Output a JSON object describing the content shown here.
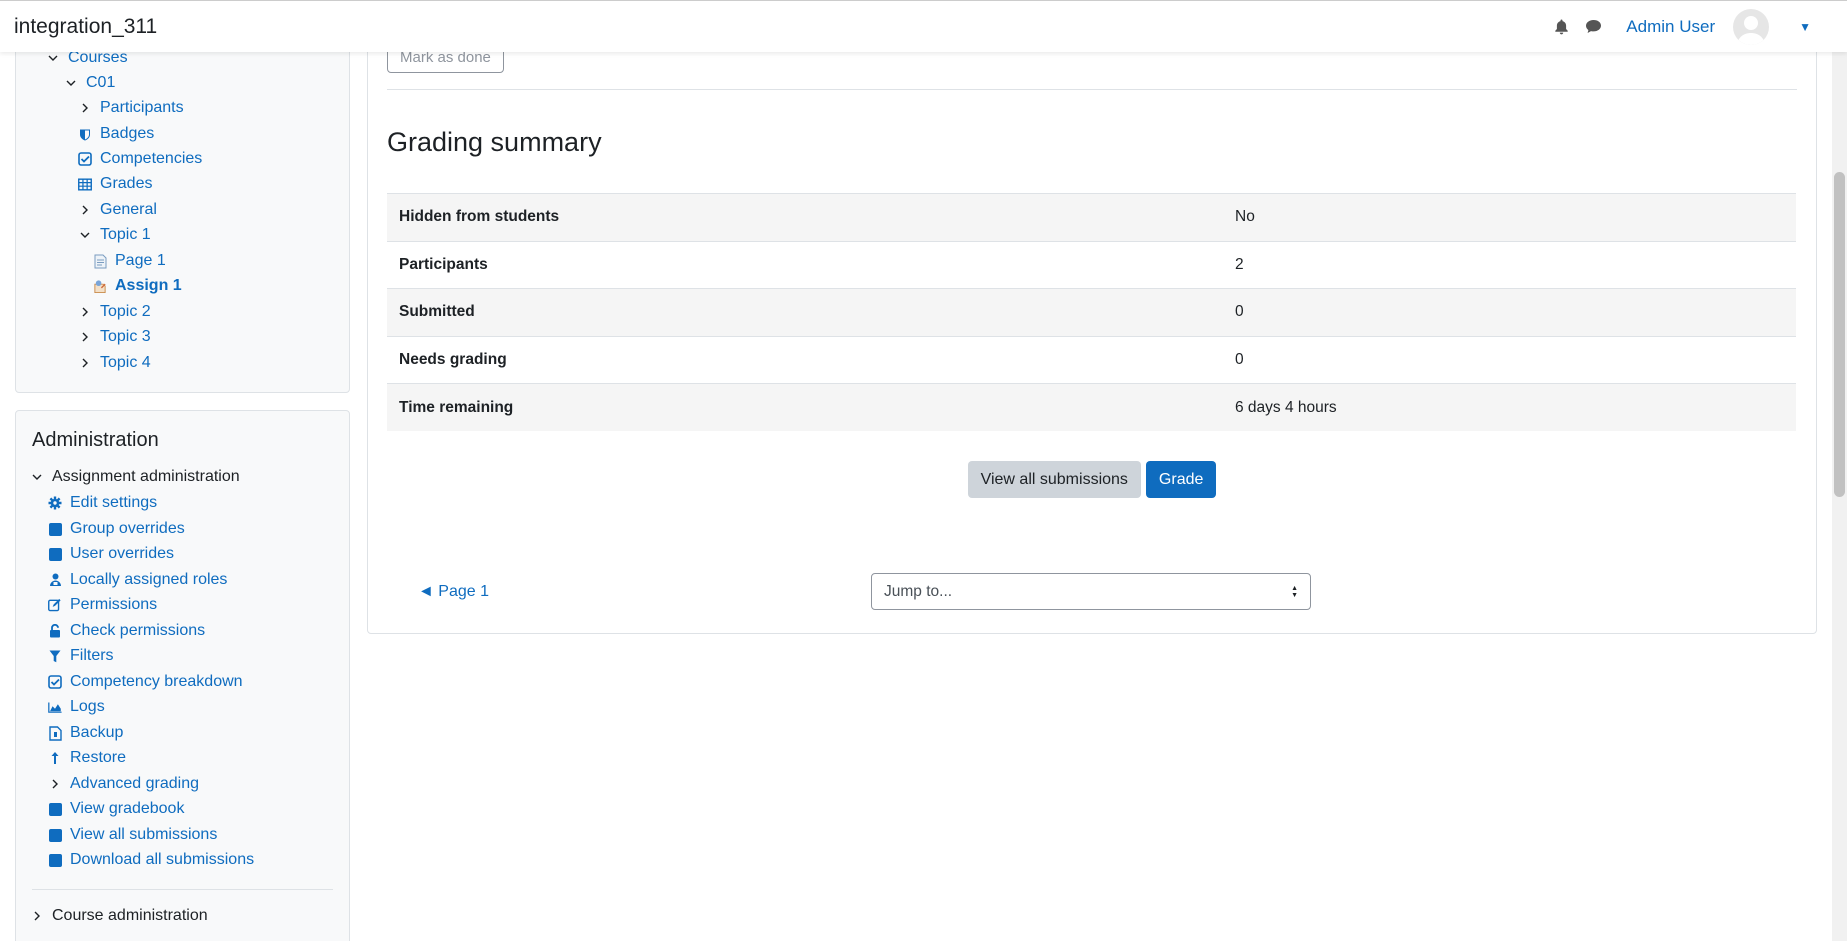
{
  "navbar": {
    "site_name": "integration_311",
    "user_name": "Admin User"
  },
  "nav_tree": [
    {
      "label": "Courses",
      "icon": "chevron-down",
      "indent": 0
    },
    {
      "label": "C01",
      "icon": "chevron-down",
      "indent": 1
    },
    {
      "label": "Participants",
      "icon": "chevron-right",
      "indent": 2
    },
    {
      "label": "Badges",
      "icon": "shield-icon",
      "indent": 2
    },
    {
      "label": "Competencies",
      "icon": "check-square-icon",
      "indent": 2
    },
    {
      "label": "Grades",
      "icon": "table-icon",
      "indent": 2
    },
    {
      "label": "General",
      "icon": "chevron-right",
      "indent": 2
    },
    {
      "label": "Topic 1",
      "icon": "chevron-down",
      "indent": 2
    },
    {
      "label": "Page 1",
      "icon": "page-icon",
      "indent": 3
    },
    {
      "label": "Assign 1",
      "icon": "assignment-icon",
      "indent": 3,
      "bold": true
    },
    {
      "label": "Topic 2",
      "icon": "chevron-right",
      "indent": 2
    },
    {
      "label": "Topic 3",
      "icon": "chevron-right",
      "indent": 2
    },
    {
      "label": "Topic 4",
      "icon": "chevron-right",
      "indent": 2
    }
  ],
  "admin": {
    "title": "Administration",
    "section": "Assignment administration",
    "items": [
      {
        "label": "Edit settings",
        "icon": "gear-icon"
      },
      {
        "label": "Group overrides",
        "icon": "square-icon"
      },
      {
        "label": "User overrides",
        "icon": "square-icon"
      },
      {
        "label": "Locally assigned roles",
        "icon": "user-roles-icon"
      },
      {
        "label": "Permissions",
        "icon": "edit-icon"
      },
      {
        "label": "Check permissions",
        "icon": "unlock-icon"
      },
      {
        "label": "Filters",
        "icon": "filter-icon"
      },
      {
        "label": "Competency breakdown",
        "icon": "check-square-icon"
      },
      {
        "label": "Logs",
        "icon": "area-chart-icon"
      },
      {
        "label": "Backup",
        "icon": "backup-file-icon"
      },
      {
        "label": "Restore",
        "icon": "upload-arrow-icon"
      },
      {
        "label": "Advanced grading",
        "icon": "chevron-right"
      },
      {
        "label": "View gradebook",
        "icon": "square-icon"
      },
      {
        "label": "View all submissions",
        "icon": "square-icon"
      },
      {
        "label": "Download all submissions",
        "icon": "square-icon"
      }
    ],
    "course_admin": "Course administration"
  },
  "main": {
    "mark_done": "Mark as done",
    "title": "Grading summary",
    "summary": [
      {
        "key": "Hidden from students",
        "value": "No"
      },
      {
        "key": "Participants",
        "value": "2"
      },
      {
        "key": "Submitted",
        "value": "0"
      },
      {
        "key": "Needs grading",
        "value": "0"
      },
      {
        "key": "Time remaining",
        "value": "6 days 4 hours"
      }
    ],
    "view_all_button": "View all submissions",
    "grade_button": "Grade",
    "prev_link": "◄ Page 1",
    "jump_placeholder": "Jump to..."
  },
  "colors": {
    "link": "#0f6cbf",
    "primary": "#0f6cbf",
    "secondary": "#ced4da"
  }
}
